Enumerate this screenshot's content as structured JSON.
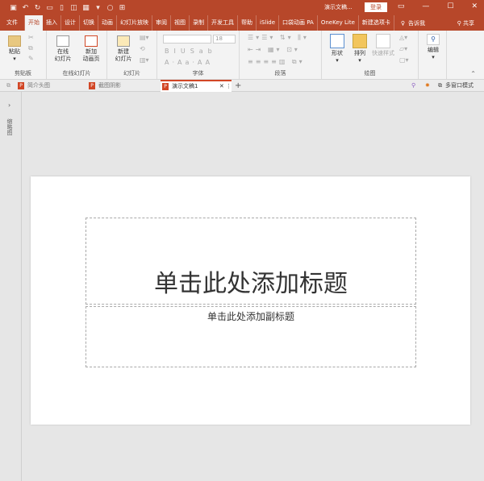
{
  "titlebar": {
    "quick_access": [
      "save-icon",
      "undo-icon",
      "redo-icon",
      "present-icon",
      "new-icon",
      "preview-icon",
      "table-icon",
      "more-icon"
    ],
    "doc_title": "演示文稿...",
    "login": "登录",
    "window_buttons": [
      "ribbon-display-icon",
      "minimize-icon",
      "maximize-icon",
      "close-icon"
    ]
  },
  "tabs": [
    "文件",
    "开始",
    "插入",
    "设计",
    "切换",
    "动画",
    "幻灯片放映",
    "审阅",
    "视图",
    "录制",
    "开发工具",
    "帮助",
    "iSlide",
    "口袋动画 PA",
    "OneKey Lite",
    "新建选项卡"
  ],
  "active_tab": "开始",
  "tell_me": "告诉我",
  "share": "共享",
  "ribbon": {
    "clipboard": {
      "paste": "粘贴",
      "label": "剪贴板"
    },
    "online": {
      "online_slide": "在线\n幻灯片",
      "new_anim": "新加\n动画页",
      "label": "在线幻灯片"
    },
    "slides": {
      "new_slide": "新建\n幻灯片",
      "label": "幻灯片"
    },
    "font": {
      "font_name": "",
      "font_size": "18",
      "label": "字体",
      "buttons": [
        "B",
        "I",
        "U",
        "S",
        "abc",
        "AV",
        "A",
        "Aa",
        "A",
        "A"
      ]
    },
    "paragraph": {
      "label": "段落"
    },
    "drawing": {
      "shape": "形状",
      "arrange": "排列",
      "quick_style": "快速样式",
      "label": "绘图"
    },
    "editing": {
      "edit": "编辑"
    }
  },
  "doc_tabs": [
    {
      "label": "简介头图"
    },
    {
      "label": "截图阴影"
    },
    {
      "label": "演示文稿1",
      "active": true
    }
  ],
  "multiwindow": "多窗口模式",
  "left_pane": "缩略图",
  "slide": {
    "title_placeholder": "单击此处添加标题",
    "subtitle_placeholder": "单击此处添加副标题"
  },
  "colors": {
    "accent": "#b7472a"
  }
}
